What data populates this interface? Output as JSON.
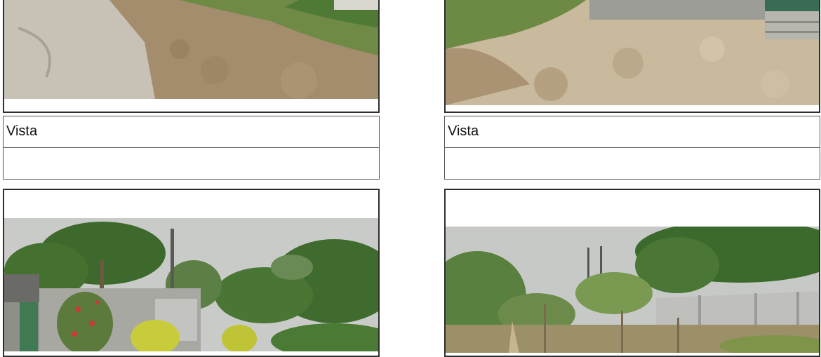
{
  "cards": [
    {
      "caption": "Vista",
      "photo_subject": "dirt-lot-with-dry-grass"
    },
    {
      "caption": "Vista",
      "photo_subject": "sandy-lot-near-wall"
    },
    {
      "caption": "",
      "photo_subject": "street-with-houses-and-trees"
    },
    {
      "caption": "",
      "photo_subject": "overgrown-lot-with-wall"
    }
  ],
  "colors": {
    "border": "#2f2f2f",
    "sky": "#c7c9c6",
    "ground_dry": "#a8977a",
    "grass": "#6f8b48",
    "foliage": "#3e6a2e"
  }
}
